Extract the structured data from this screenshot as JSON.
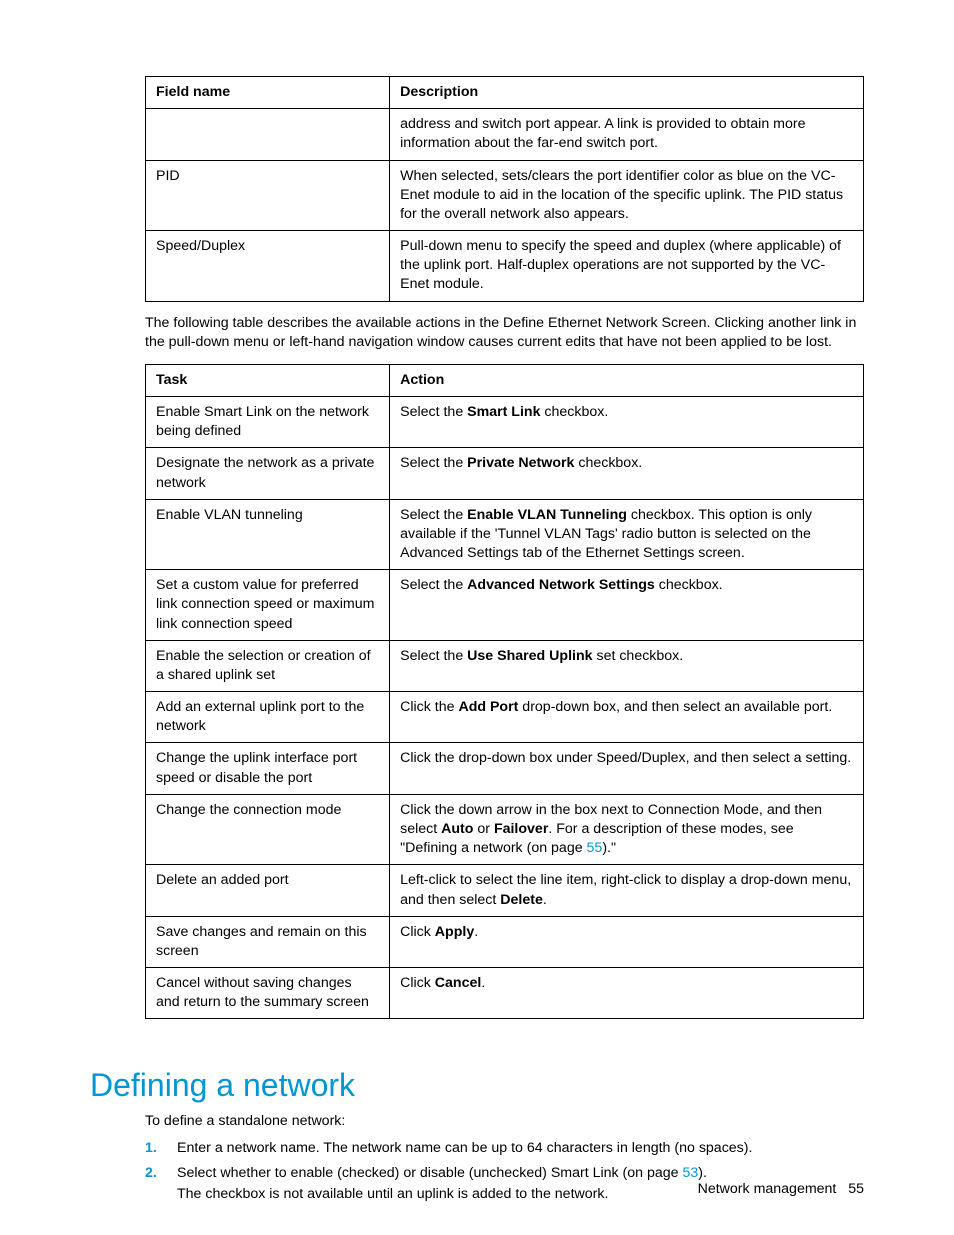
{
  "table1": {
    "headers": [
      "Field name",
      "Description"
    ],
    "rows": [
      {
        "c0": "",
        "c1": "address and switch port appear. A link is provided to obtain more information about the far-end switch port."
      },
      {
        "c0": "PID",
        "c1": "When selected, sets/clears the port identifier color as blue on the VC-Enet module to aid in the location of the specific uplink. The PID status for the overall network also appears."
      },
      {
        "c0": "Speed/Duplex",
        "c1": "Pull-down menu to specify the speed and duplex (where applicable) of the uplink port. Half-duplex operations are not supported by the VC-Enet module."
      }
    ]
  },
  "para1": "The following table describes the available actions in the Define Ethernet Network Screen. Clicking another link in the pull-down menu or left-hand navigation window causes current edits that have not been applied to be lost.",
  "table2": {
    "headers": [
      "Task",
      "Action"
    ],
    "rows": [
      {
        "c0": "Enable Smart Link on the network being defined",
        "c1_pre": "Select the ",
        "c1_b": "Smart Link",
        "c1_post": " checkbox."
      },
      {
        "c0": "Designate the network as a private network",
        "c1_pre": "Select the ",
        "c1_b": "Private Network",
        "c1_post": " checkbox."
      },
      {
        "c0": "Enable VLAN tunneling",
        "c1_pre": "Select the ",
        "c1_b": "Enable VLAN Tunneling",
        "c1_post": " checkbox. This option is only available if the 'Tunnel VLAN Tags' radio button is selected on the Advanced Settings tab of the Ethernet Settings screen."
      },
      {
        "c0": "Set a custom value for preferred link connection speed or maximum link connection speed",
        "c1_pre": "Select the ",
        "c1_b": "Advanced Network Settings",
        "c1_post": " checkbox."
      },
      {
        "c0": "Enable the selection or creation of a shared uplink set",
        "c1_pre": "Select the ",
        "c1_b": "Use Shared Uplink",
        "c1_post": " set checkbox."
      },
      {
        "c0": "Add an external uplink port to the network",
        "c1_pre": "Click the ",
        "c1_b": "Add Port",
        "c1_post": " drop-down box, and then select an available port."
      },
      {
        "c0": "Change the uplink interface port speed or disable the port",
        "c1_plain": "Click the drop-down box under Speed/Duplex, and then select a setting."
      },
      {
        "c0": "Change the connection mode",
        "c1_connmode_pre": "Click the down arrow in the box next to Connection Mode, and then select ",
        "c1_connmode_b1": "Auto",
        "c1_connmode_mid": " or ",
        "c1_connmode_b2": "Failover",
        "c1_connmode_post1": ". For a description of these modes, see \"Defining a network (on page ",
        "c1_connmode_link": "55",
        "c1_connmode_post2": ").\""
      },
      {
        "c0": "Delete an added port",
        "c1_del_pre": "Left-click to select the line item, right-click to display a drop-down menu, and then select ",
        "c1_del_b": "Delete",
        "c1_del_post": "."
      },
      {
        "c0": "Save changes and remain on this screen",
        "c1_pre": "Click ",
        "c1_b": "Apply",
        "c1_post": "."
      },
      {
        "c0": "Cancel without saving changes and return to the summary screen",
        "c1_pre": "Click ",
        "c1_b": "Cancel",
        "c1_post": "."
      }
    ]
  },
  "section_title": "Defining a network",
  "intro": "To define a standalone network:",
  "steps": [
    {
      "num": "1.",
      "text": "Enter a network name. The network name can be up to 64 characters in length (no spaces)."
    },
    {
      "num": "2.",
      "line1_pre": "Select whether to enable (checked) or disable (unchecked) Smart Link (on page ",
      "line1_link": "53",
      "line1_post": ").",
      "line2": "The checkbox is not available until an uplink is added to the network."
    }
  ],
  "footer": {
    "label": "Network management",
    "page": "55"
  }
}
